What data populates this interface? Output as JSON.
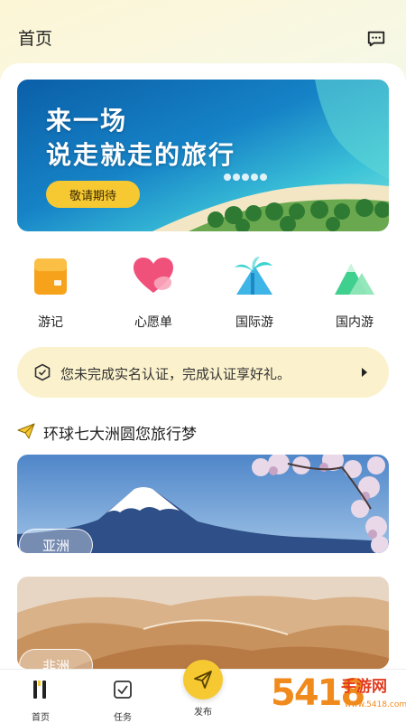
{
  "header": {
    "title": "首页",
    "message_icon": "chat-bubble-icon"
  },
  "banner": {
    "line1": "来一场",
    "line2": "说走就走的旅行",
    "button_label": "敬请期待"
  },
  "quick_actions": [
    {
      "label": "游记",
      "icon": "journal-icon"
    },
    {
      "label": "心愿单",
      "icon": "heart-icon"
    },
    {
      "label": "国际游",
      "icon": "palm-tree-icon"
    },
    {
      "label": "国内游",
      "icon": "mountain-icon"
    }
  ],
  "verify_notice": {
    "text": "您未完成实名认证，完成认证享好礼。",
    "icon": "shield-icon"
  },
  "section": {
    "title": "环球七大洲圆您旅行梦",
    "icon": "paper-plane-icon"
  },
  "destinations": [
    {
      "tag": "亚洲"
    },
    {
      "tag": "非洲"
    }
  ],
  "tabbar": {
    "tabs": [
      {
        "label": "首页",
        "icon": "home-icon",
        "active": true
      },
      {
        "label": "任务",
        "icon": "task-check-icon",
        "active": false
      },
      {
        "label": "发布",
        "icon": "send-icon",
        "active": false
      }
    ]
  },
  "watermark": {
    "number": "5418",
    "brand": "手游网",
    "url": "www.5418.com"
  },
  "colors": {
    "accent": "#f6c933",
    "notice_bg": "#fbf1cc"
  }
}
